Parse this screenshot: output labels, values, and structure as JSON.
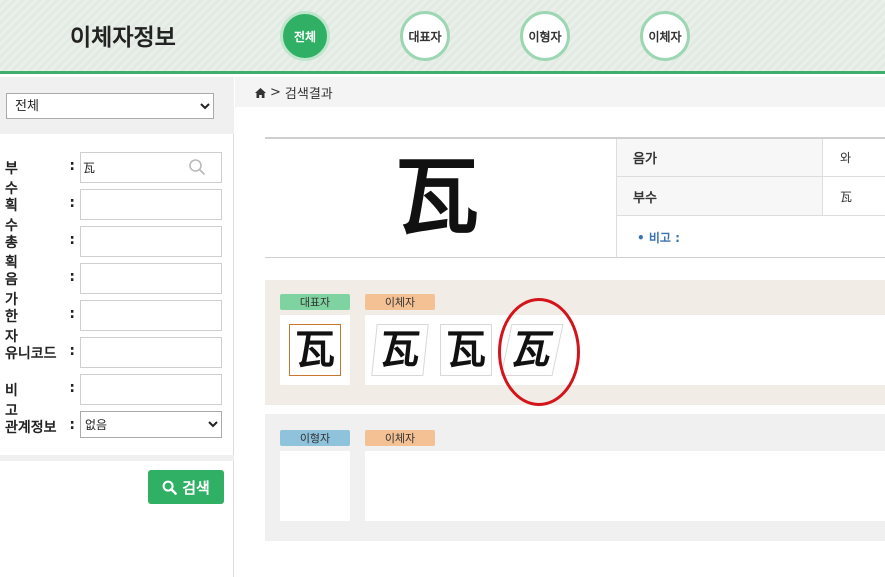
{
  "header": {
    "logo": "이체자정보",
    "nav": [
      {
        "label": "전체",
        "active": true
      },
      {
        "label": "대표자",
        "active": false
      },
      {
        "label": "이형자",
        "active": false
      },
      {
        "label": "이체자",
        "active": false
      }
    ]
  },
  "sidebar": {
    "type_select": {
      "selected": "전체"
    },
    "fields": [
      {
        "label": "부 수",
        "value": "瓦"
      },
      {
        "label": "획 수",
        "value": ""
      },
      {
        "label": "총 획",
        "value": ""
      },
      {
        "label": "음 가",
        "value": ""
      },
      {
        "label": "한 자",
        "value": ""
      },
      {
        "label": "유니코드",
        "value": ""
      },
      {
        "label": "비 고",
        "value": ""
      }
    ],
    "relation": {
      "label": "관계정보",
      "selected": "없음"
    },
    "search_button": "검색"
  },
  "breadcrumb": {
    "separator": ">",
    "current": "검색결과"
  },
  "result": {
    "character": "瓦",
    "rows": [
      {
        "key": "음가",
        "value": "와"
      },
      {
        "key": "부수",
        "value": "瓦"
      }
    ],
    "note_label": "• 비고 :"
  },
  "variants": {
    "representative_tag": "대표자",
    "variant_tag": "이체자",
    "representative": [
      "瓦"
    ],
    "variant_glyphs": [
      "瓦",
      "瓦",
      "瓦"
    ]
  },
  "lower": {
    "shape_tag": "이형자",
    "variant_tag": "이체자"
  },
  "colors": {
    "accent": "#2fb064",
    "highlight_circle": "#d4141b",
    "note": "#3a73b0"
  }
}
